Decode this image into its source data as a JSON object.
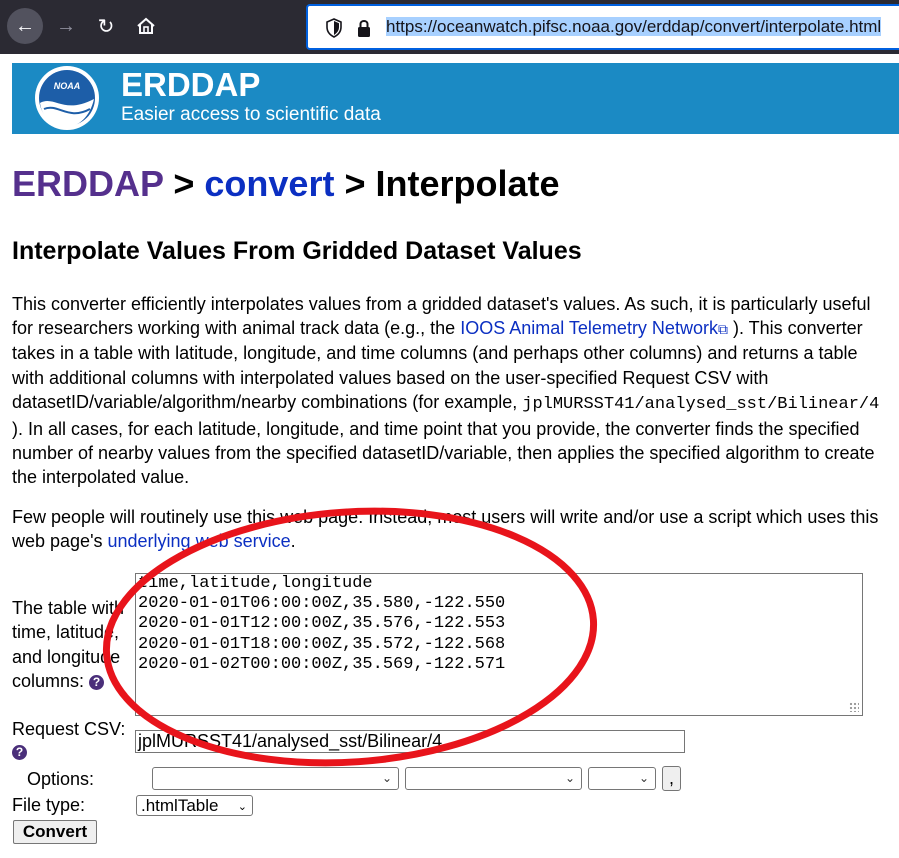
{
  "browser": {
    "url": "https://oceanwatch.pifsc.noaa.gov/erddap/convert/interpolate.html"
  },
  "banner": {
    "logo_text": "NOAA",
    "title": "ERDDAP",
    "subtitle": "Easier access to scientific data"
  },
  "breadcrumb": {
    "root": "ERDDAP",
    "sep1": " > ",
    "section": "convert",
    "sep2": " > ",
    "current": "Interpolate"
  },
  "heading": "Interpolate Values From Gridded Dataset Values",
  "intro": {
    "p1_a": "This converter efficiently interpolates values from a gridded dataset's values. As such, it is particularly useful for researchers working with animal track data (e.g., the ",
    "p1_link": "IOOS Animal Telemetry Network",
    "p1_b": " ). This converter takes in a table with latitude, longitude, and time columns (and perhaps other columns) and returns a table with additional columns with interpolated values based on the user-specified Request CSV with datasetID/variable/algorithm/nearby combinations (for example, ",
    "p1_code": "jplMURSST41/analysed_sst/Bilinear/4",
    "p1_c": " ). In all cases, for each latitude, longitude, and time point that you provide, the converter finds the specified number of nearby values from the specified datasetID/variable, then applies the specified algorithm to create the interpolated value.",
    "p2_a": "Few people will routinely use this web page. Instead, most users will write and/or use a script which uses this web page's ",
    "p2_link": "underlying web service",
    "p2_b": "."
  },
  "form": {
    "table_label": "The table with time, latitude, and longitude columns:",
    "table_rows": [
      "time,latitude,longitude",
      "2020-01-01T06:00:00Z,35.580,-122.550",
      "2020-01-01T12:00:00Z,35.576,-122.553",
      "2020-01-01T18:00:00Z,35.572,-122.568",
      "2020-01-02T00:00:00Z,35.569,-122.571"
    ],
    "request_label": "Request CSV:",
    "request_value": "jplMURSST41/analysed_sst/Bilinear/4",
    "options_label": "Options:",
    "comma_label": ",",
    "filetype_label": "File type:",
    "filetype_value": ".htmlTable",
    "convert_label": "Convert",
    "help_glyph": "?"
  },
  "colors": {
    "banner": "#1b8ac4",
    "annotation": "#e8141b",
    "link": "#0b2fc2",
    "visited": "#55308d"
  }
}
